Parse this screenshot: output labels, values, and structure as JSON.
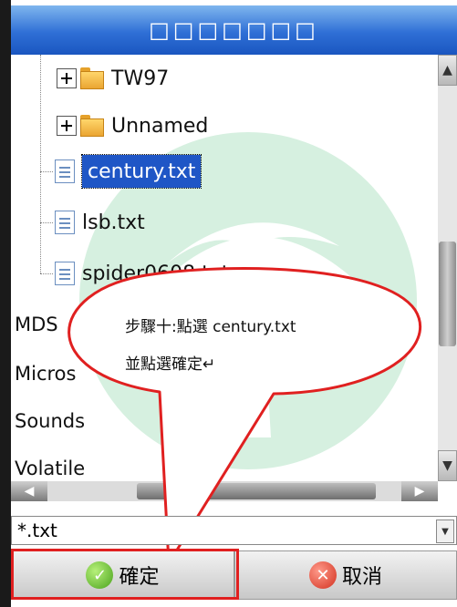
{
  "window": {
    "title": "□□□□□□□"
  },
  "tree": {
    "folders": [
      {
        "label": "TW97"
      },
      {
        "label": "Unnamed"
      }
    ],
    "files": [
      {
        "label": "century.txt",
        "selected": true
      },
      {
        "label": "lsb.txt"
      },
      {
        "label": "spider0608.txt"
      }
    ],
    "items": [
      "MDS",
      "Micros",
      "Sounds",
      "Volatile"
    ]
  },
  "callout": {
    "line1": "步驟十:點選 century.txt",
    "line2": "並點選確定↵"
  },
  "filter": {
    "value": "*.txt"
  },
  "buttons": {
    "ok": "確定",
    "cancel": "取消"
  },
  "colors": {
    "title_bar": "#2f6fd6",
    "selection": "#1f56c6",
    "highlight": "#e02020",
    "watermark": "#d6f0e0"
  },
  "icons": {
    "scroll_up": "chevron-up-icon",
    "scroll_down": "chevron-down-icon",
    "scroll_left": "chevron-left-icon",
    "scroll_right": "chevron-right-icon"
  }
}
